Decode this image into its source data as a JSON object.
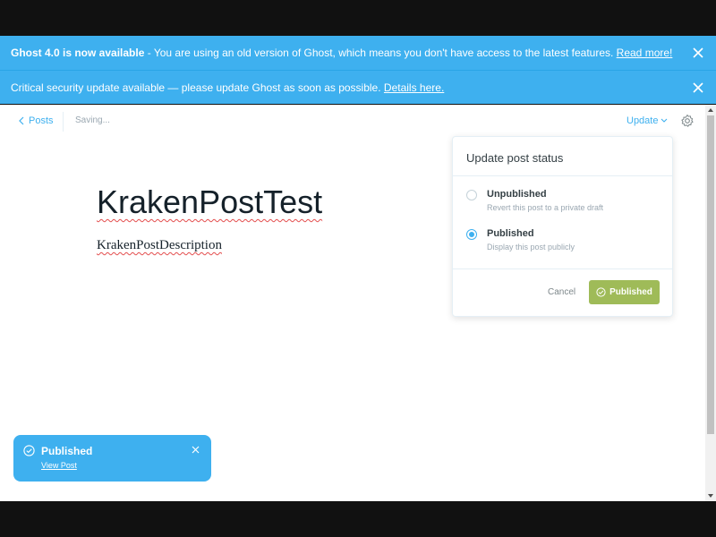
{
  "banners": [
    {
      "strong": "Ghost 4.0 is now available",
      "text": " - You are using an old version of Ghost, which means you don't have access to the latest features.",
      "link": "Read more!"
    },
    {
      "text": "Critical security update available — please update Ghost as soon as possible.",
      "link": "Details here."
    }
  ],
  "header": {
    "back_label": "Posts",
    "saving_label": "Saving...",
    "update_label": "Update"
  },
  "post": {
    "title": "KrakenPostTest",
    "body": "KrakenPostDescription"
  },
  "status_dropdown": {
    "title": "Update post status",
    "options": [
      {
        "label": "Unpublished",
        "description": "Revert this post to a private draft",
        "selected": false
      },
      {
        "label": "Published",
        "description": "Display this post publicly",
        "selected": true
      }
    ],
    "cancel_label": "Cancel",
    "confirm_label": "Published"
  },
  "toast": {
    "title": "Published",
    "link": "View Post"
  },
  "colors": {
    "accent": "#3eb0ef",
    "published_green": "#9fbb58"
  },
  "icons": {
    "close": "close-icon",
    "back": "chevron-left-icon",
    "update_caret": "chevron-down-icon",
    "settings": "gear-icon",
    "check": "check-circle-icon"
  }
}
